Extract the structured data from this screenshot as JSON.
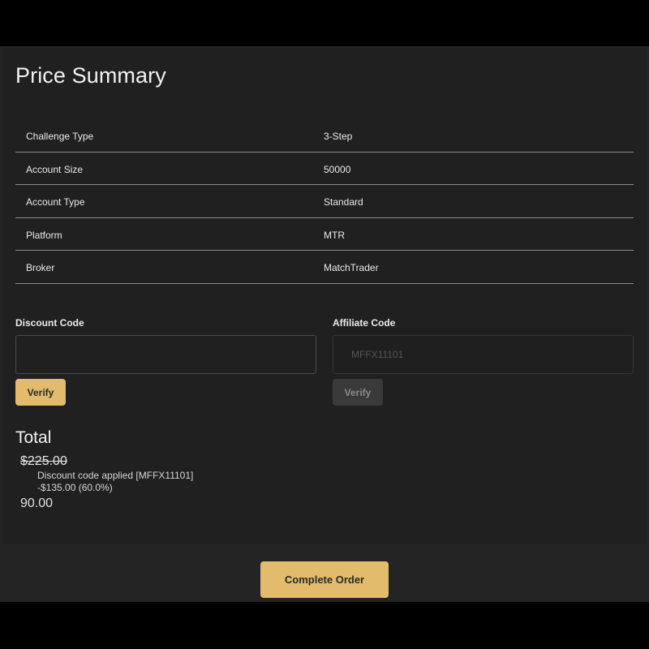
{
  "title": "Price Summary",
  "summary": [
    {
      "label": "Challenge Type",
      "value": "3-Step"
    },
    {
      "label": "Account Size",
      "value": "50000"
    },
    {
      "label": "Account Type",
      "value": "Standard"
    },
    {
      "label": "Platform",
      "value": "MTR"
    },
    {
      "label": "Broker",
      "value": "MatchTrader"
    }
  ],
  "discount": {
    "label": "Discount Code",
    "value": "",
    "verify_label": "Verify"
  },
  "affiliate": {
    "label": "Affiliate Code",
    "value": "MFFX11101",
    "verify_label": "Verify"
  },
  "total": {
    "heading": "Total",
    "original_price": "$225.00",
    "discount_applied": "Discount code applied [MFFX11101]",
    "discount_amount": "-$135.00 (60.0%)",
    "final_price": "90.00"
  },
  "actions": {
    "complete_label": "Complete Order"
  },
  "colors": {
    "accent": "#e2bb6c",
    "background": "#202020"
  }
}
